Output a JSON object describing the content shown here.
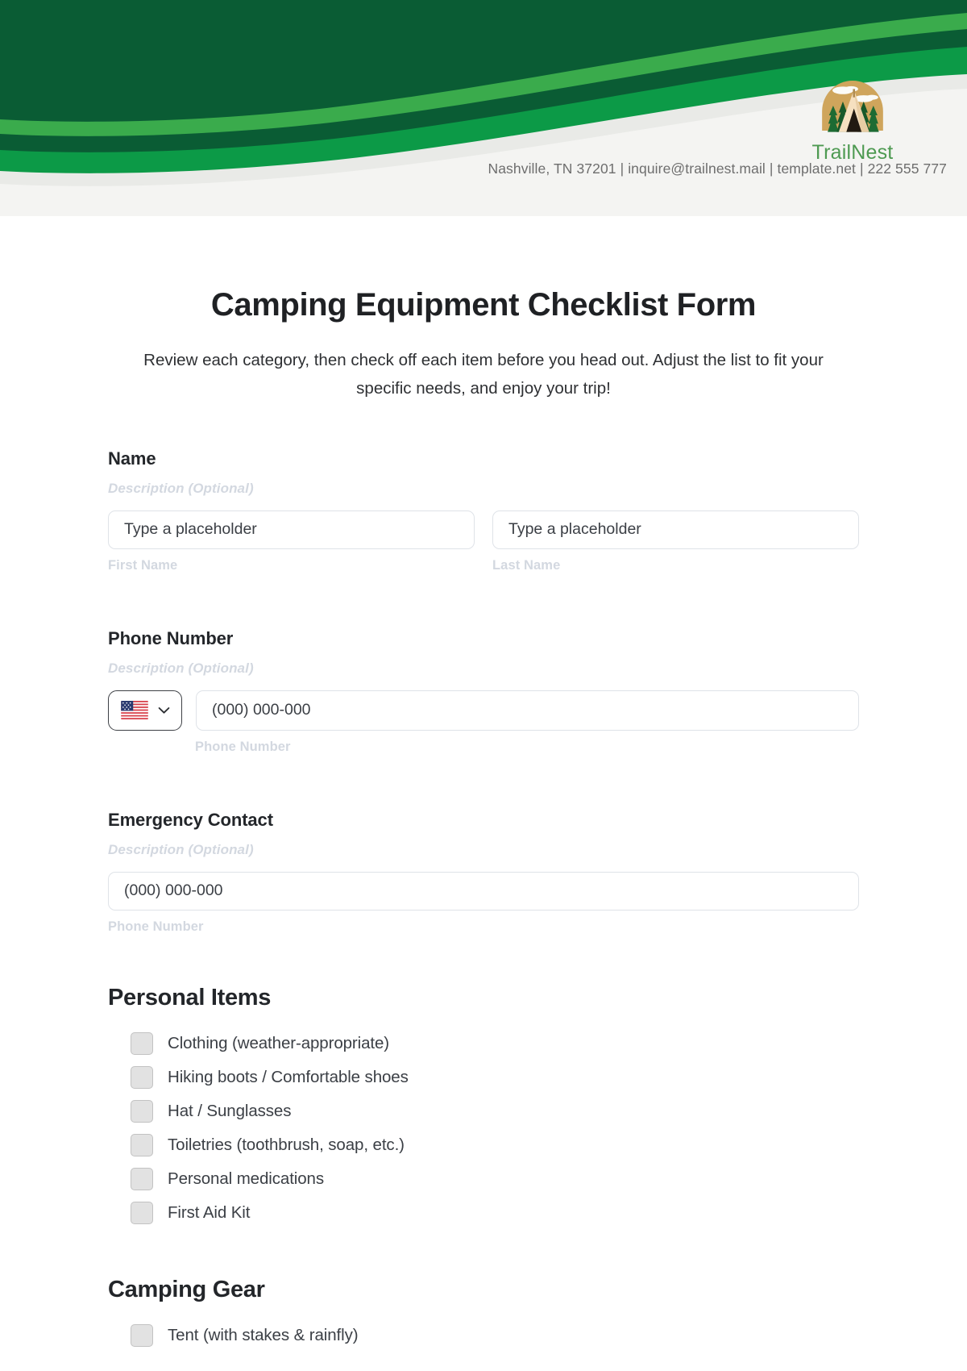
{
  "header": {
    "brand_name": "TrailNest",
    "contact_line": "Nashville, TN 37201 | inquire@trailnest.mail | template.net | 222 555 777",
    "logo_icon": "camping-tent-forest-logo",
    "colors": {
      "wave_dark": "#0a5c34",
      "wave_bright": "#3aab4c",
      "wave_mid": "#0c9a47",
      "banner_bg": "#f4f4f2",
      "brand_text": "#4e9a52"
    }
  },
  "form": {
    "title": "Camping Equipment Checklist Form",
    "subtitle": "Review each category, then check off each item before you head out. Adjust the list to fit your specific needs, and enjoy your trip!"
  },
  "fields": {
    "name": {
      "label": "Name",
      "description": "Description (Optional)",
      "first": {
        "placeholder": "Type a placeholder",
        "sub_label": "First Name"
      },
      "last": {
        "placeholder": "Type a placeholder",
        "sub_label": "Last Name"
      }
    },
    "phone": {
      "label": "Phone Number",
      "description": "Description (Optional)",
      "country_flag": "us-flag-icon",
      "dropdown_icon": "chevron-down-icon",
      "placeholder": "(000) 000-000",
      "sub_label": "Phone Number"
    },
    "emergency": {
      "label": "Emergency Contact",
      "description": "Description (Optional)",
      "placeholder": "(000) 000-000",
      "sub_label": "Phone Number"
    }
  },
  "checklists": [
    {
      "heading": "Personal Items",
      "items": [
        "Clothing (weather-appropriate)",
        "Hiking boots / Comfortable shoes",
        "Hat / Sunglasses",
        "Toiletries (toothbrush, soap, etc.)",
        "Personal medications",
        "First Aid Kit"
      ]
    },
    {
      "heading": "Camping Gear",
      "items": [
        "Tent (with stakes & rainfly)"
      ]
    }
  ]
}
